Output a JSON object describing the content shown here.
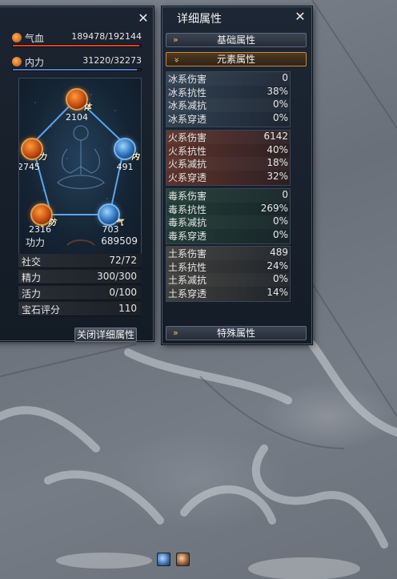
{
  "character_panel": {
    "hp": {
      "label": "气血",
      "value": "189478/192144",
      "fill": 0.986
    },
    "mp": {
      "label": "内力",
      "value": "31220/32273",
      "fill": 0.967
    },
    "pentagon": {
      "top": {
        "tag": "体",
        "value": "2104"
      },
      "left": {
        "tag": "力",
        "value": "2745"
      },
      "right": {
        "tag": "内",
        "value": "491"
      },
      "bottom_left": {
        "tag": "防",
        "value": "2316"
      },
      "bottom_right": {
        "tag": "气",
        "value": "703"
      }
    },
    "power": {
      "label": "功力",
      "value": "689509"
    },
    "rows": [
      {
        "label": "社交",
        "value": "72/72"
      },
      {
        "label": "精力",
        "value": "300/300"
      },
      {
        "label": "活力",
        "value": "0/100"
      },
      {
        "label": "宝石评分",
        "value": "110"
      }
    ],
    "close_detail_button": "关闭详细属性"
  },
  "detail_panel": {
    "title": "详细属性",
    "sections": {
      "basic": "基础属性",
      "element": "元素属性",
      "special": "特殊属性"
    },
    "groups": [
      {
        "id": "ice",
        "rows": [
          {
            "label": "冰系伤害",
            "value": "0"
          },
          {
            "label": "冰系抗性",
            "value": "38%"
          },
          {
            "label": "冰系减抗",
            "value": "0%"
          },
          {
            "label": "冰系穿透",
            "value": "0%"
          }
        ]
      },
      {
        "id": "fire",
        "rows": [
          {
            "label": "火系伤害",
            "value": "6142"
          },
          {
            "label": "火系抗性",
            "value": "40%"
          },
          {
            "label": "火系减抗",
            "value": "18%"
          },
          {
            "label": "火系穿透",
            "value": "32%"
          }
        ]
      },
      {
        "id": "poison",
        "rows": [
          {
            "label": "毒系伤害",
            "value": "0"
          },
          {
            "label": "毒系抗性",
            "value": "269%"
          },
          {
            "label": "毒系减抗",
            "value": "0%"
          },
          {
            "label": "毒系穿透",
            "value": "0%"
          }
        ]
      },
      {
        "id": "earth",
        "rows": [
          {
            "label": "土系伤害",
            "value": "489"
          },
          {
            "label": "土系抗性",
            "value": "24%"
          },
          {
            "label": "土系减抗",
            "value": "0%"
          },
          {
            "label": "土系穿透",
            "value": "14%"
          }
        ]
      }
    ]
  },
  "icons": {
    "close": "close-icon",
    "chevron": "double-chevron-icon"
  },
  "colors": {
    "hp_bar": "#d8402a",
    "mp_bar": "#4f79c8",
    "accent_gold": "#d9a050"
  }
}
